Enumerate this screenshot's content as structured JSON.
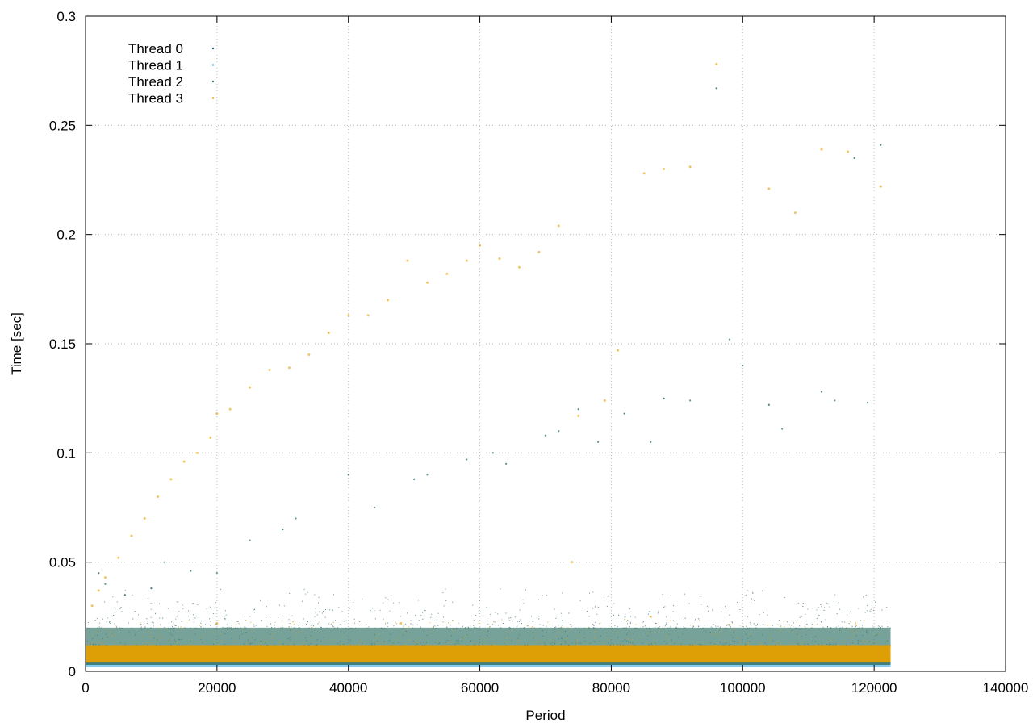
{
  "chart_data": {
    "type": "scatter",
    "title": "",
    "xlabel": "Period",
    "ylabel": "Time [sec]",
    "xlim": [
      0,
      140000
    ],
    "ylim": [
      0,
      0.3
    ],
    "xticks": [
      0,
      20000,
      40000,
      60000,
      80000,
      100000,
      120000,
      140000
    ],
    "xtick_labels": [
      "0",
      "20000",
      "40000",
      "60000",
      "80000",
      "100000",
      "120000",
      "140000"
    ],
    "yticks": [
      0,
      0.05,
      0.1,
      0.15,
      0.2,
      0.25,
      0.3
    ],
    "ytick_labels": [
      "0",
      "0.05",
      "0.1",
      "0.15",
      "0.2",
      "0.25",
      "0.3"
    ],
    "grid": true,
    "legend_position": "top-left",
    "series": [
      {
        "name": "Thread 0",
        "color": "#1f5f6b",
        "x_range": [
          0,
          122500
        ],
        "typical_band": [
          0.003,
          0.012
        ],
        "points": [
          [
            2000,
            0.045
          ],
          [
            6000,
            0.035
          ],
          [
            10000,
            0.038
          ],
          [
            16000,
            0.046
          ],
          [
            30000,
            0.065
          ],
          [
            40000,
            0.09
          ],
          [
            50000,
            0.088
          ],
          [
            62000,
            0.1
          ],
          [
            70000,
            0.108
          ],
          [
            75000,
            0.12
          ],
          [
            82000,
            0.118
          ],
          [
            88000,
            0.125
          ],
          [
            96000,
            0.267
          ],
          [
            100000,
            0.14
          ],
          [
            104000,
            0.122
          ],
          [
            112000,
            0.128
          ],
          [
            117000,
            0.235
          ],
          [
            121000,
            0.241
          ]
        ]
      },
      {
        "name": "Thread 1",
        "color": "#56b4e9",
        "x_range": [
          0,
          122500
        ],
        "typical_band": [
          0.002,
          0.004
        ],
        "points": [
          [
            5000,
            0.004
          ],
          [
            40000,
            0.004
          ],
          [
            80000,
            0.005
          ],
          [
            100000,
            0.004
          ]
        ]
      },
      {
        "name": "Thread 2",
        "color": "#3d7a6e",
        "x_range": [
          0,
          122500
        ],
        "typical_band": [
          0.003,
          0.02
        ],
        "points": [
          [
            3000,
            0.04
          ],
          [
            12000,
            0.05
          ],
          [
            20000,
            0.045
          ],
          [
            25000,
            0.06
          ],
          [
            32000,
            0.07
          ],
          [
            44000,
            0.075
          ],
          [
            52000,
            0.09
          ],
          [
            58000,
            0.097
          ],
          [
            64000,
            0.095
          ],
          [
            72000,
            0.11
          ],
          [
            78000,
            0.105
          ],
          [
            86000,
            0.105
          ],
          [
            92000,
            0.124
          ],
          [
            98000,
            0.152
          ],
          [
            106000,
            0.111
          ],
          [
            114000,
            0.124
          ],
          [
            119000,
            0.123
          ]
        ]
      },
      {
        "name": "Thread 3",
        "color": "#e69f00",
        "x_range": [
          0,
          122500
        ],
        "typical_band": [
          0.004,
          0.012
        ],
        "points": [
          [
            1000,
            0.03
          ],
          [
            2000,
            0.037
          ],
          [
            3000,
            0.043
          ],
          [
            5000,
            0.052
          ],
          [
            7000,
            0.062
          ],
          [
            9000,
            0.07
          ],
          [
            11000,
            0.08
          ],
          [
            13000,
            0.088
          ],
          [
            15000,
            0.096
          ],
          [
            17000,
            0.1
          ],
          [
            19000,
            0.107
          ],
          [
            20000,
            0.118
          ],
          [
            22000,
            0.12
          ],
          [
            25000,
            0.13
          ],
          [
            28000,
            0.138
          ],
          [
            31000,
            0.139
          ],
          [
            34000,
            0.145
          ],
          [
            37000,
            0.155
          ],
          [
            40000,
            0.163
          ],
          [
            43000,
            0.163
          ],
          [
            46000,
            0.17
          ],
          [
            49000,
            0.188
          ],
          [
            52000,
            0.178
          ],
          [
            55000,
            0.182
          ],
          [
            58000,
            0.188
          ],
          [
            60000,
            0.195
          ],
          [
            63000,
            0.189
          ],
          [
            66000,
            0.185
          ],
          [
            69000,
            0.192
          ],
          [
            72000,
            0.204
          ],
          [
            75000,
            0.117
          ],
          [
            79000,
            0.124
          ],
          [
            81000,
            0.147
          ],
          [
            85000,
            0.228
          ],
          [
            88000,
            0.23
          ],
          [
            92000,
            0.231
          ],
          [
            96000,
            0.278
          ],
          [
            104000,
            0.221
          ],
          [
            108000,
            0.21
          ],
          [
            112000,
            0.239
          ],
          [
            116000,
            0.238
          ],
          [
            121000,
            0.222
          ],
          [
            74000,
            0.05
          ],
          [
            20000,
            0.022
          ],
          [
            48000,
            0.022
          ],
          [
            86000,
            0.025
          ]
        ]
      }
    ]
  }
}
